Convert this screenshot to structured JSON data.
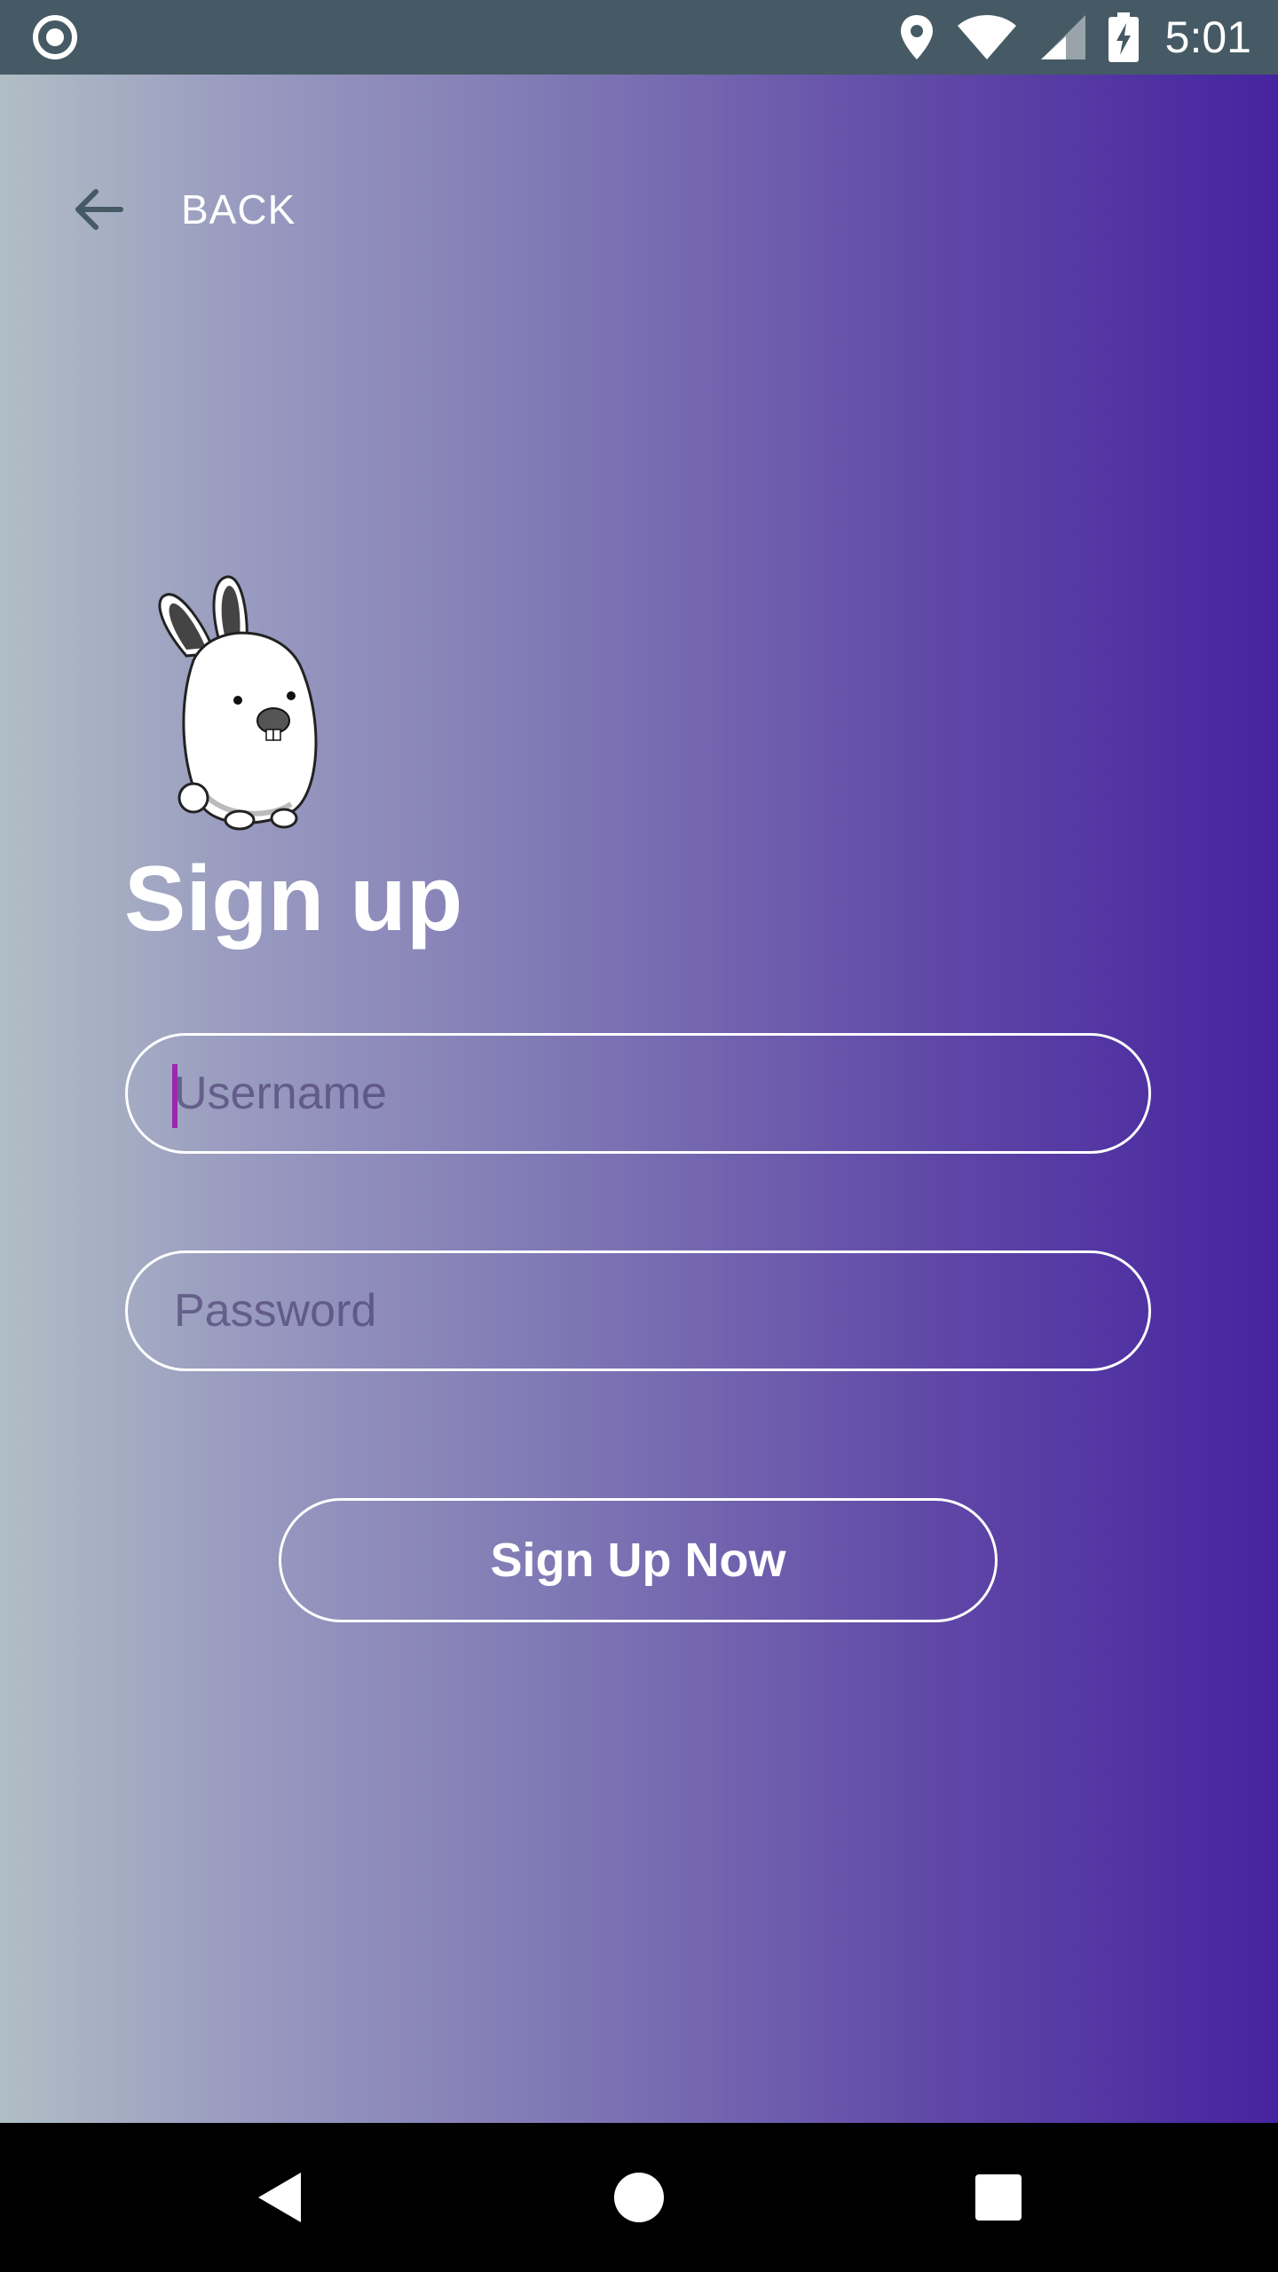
{
  "status_bar": {
    "time": "5:01",
    "icons": [
      "record-icon",
      "location-icon",
      "wifi-icon",
      "signal-icon",
      "battery-charging-icon"
    ]
  },
  "header": {
    "back_label": "BACK",
    "back_icon": "arrow-left-icon"
  },
  "main": {
    "illustration": "bunny-illustration",
    "title": "Sign up",
    "username_placeholder": "Username",
    "username_value": "",
    "password_placeholder": "Password",
    "password_value": "",
    "submit_label": "Sign Up Now"
  },
  "nav_bar": {
    "icons": [
      "nav-back-icon",
      "nav-home-icon",
      "nav-recents-icon"
    ]
  },
  "colors": {
    "status_bar": "#455A64",
    "gradient_start": "#B0BEC5",
    "gradient_end": "#4624A0",
    "caret": "#9C27B0",
    "text": "#FFFFFF"
  }
}
